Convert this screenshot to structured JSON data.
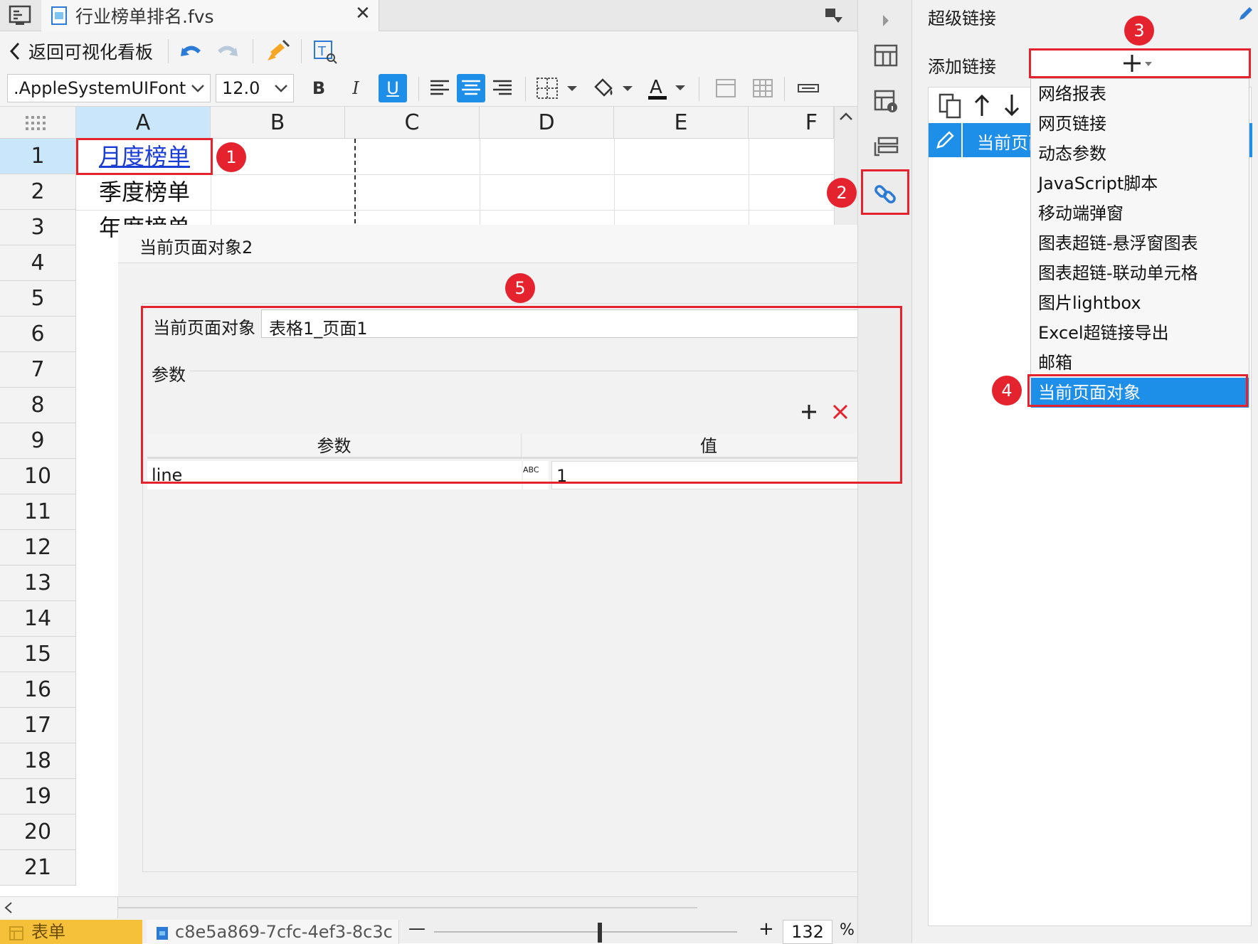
{
  "file_tab": {
    "name": "行业榜单排名.fvs",
    "close": "✕"
  },
  "toolbar": {
    "back_label": "返回可视化看板",
    "font_name": ".AppleSystemUIFont",
    "font_size": "12.0",
    "bold": "B",
    "italic": "I",
    "underline": "U",
    "font_color": "A"
  },
  "sheet": {
    "columns": [
      "A",
      "B",
      "C",
      "D",
      "E",
      "F"
    ],
    "rows": [
      "1",
      "2",
      "3",
      "4",
      "5",
      "6",
      "7",
      "8",
      "9",
      "10",
      "11",
      "12",
      "13",
      "14",
      "15",
      "16",
      "17",
      "18",
      "19",
      "20",
      "21"
    ],
    "cells": {
      "a1": "月度榜单",
      "a2": "季度榜单",
      "a3": "年度榜单"
    }
  },
  "dialog": {
    "title": "当前页面对象2",
    "object_label": "当前页面对象",
    "object_value": "表格1_页面1",
    "params_label": "参数",
    "table_headers": [
      "参数",
      "值"
    ],
    "param_row": {
      "name": "line",
      "type_icon": "ABC",
      "value": "1"
    }
  },
  "right_panel": {
    "title": "超级链接",
    "add_label": "添加链接",
    "list_item": "当前页面对象",
    "menu": [
      "网络报表",
      "网页链接",
      "动态参数",
      "JavaScript脚本",
      "移动端弹窗",
      "图表超链-悬浮窗图表",
      "图表超链-联动单元格",
      "图片lightbox",
      "Excel超链接导出",
      "邮箱",
      "当前页面对象"
    ]
  },
  "annotations": [
    "1",
    "2",
    "3",
    "4",
    "5"
  ],
  "bottom_bar": {
    "sheet_tab": "表单",
    "report_id": "c8e5a869-7cfc-4ef3-8c3c",
    "zoom_minus": "—",
    "zoom_plus": "+",
    "zoom_value": "132",
    "zoom_unit": "%"
  },
  "colors": {
    "accent": "#1e8fe8",
    "annotation": "#e5232e",
    "selected_header": "#c9e6fa",
    "link_text": "#1a3dd6"
  }
}
